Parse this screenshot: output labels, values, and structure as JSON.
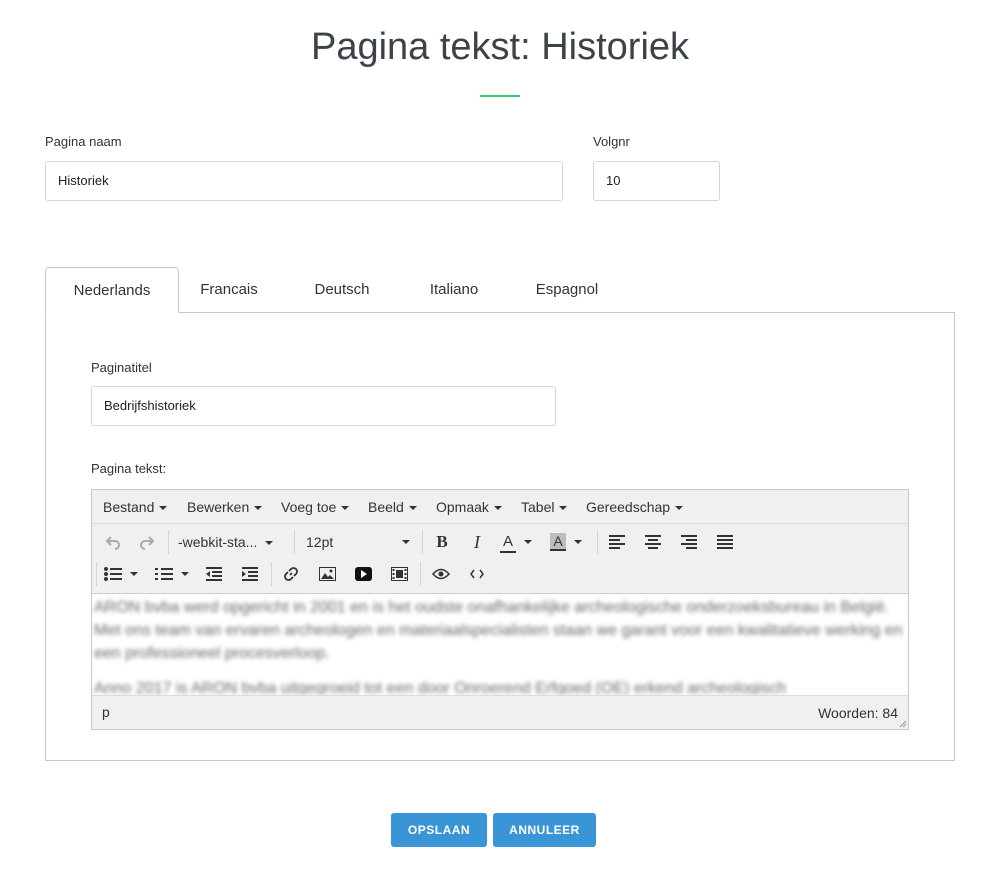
{
  "page": {
    "title": "Pagina tekst: Historiek"
  },
  "form": {
    "name_label": "Pagina naam",
    "name_value": "Historiek",
    "order_label": "Volgnr",
    "order_value": "10"
  },
  "tabs": [
    "Nederlands",
    "Francais",
    "Deutsch",
    "Italiano",
    "Espagnol"
  ],
  "active_tab": "Nederlands",
  "panel": {
    "title_label": "Paginatitel",
    "title_value": "Bedrijfshistoriek",
    "text_label": "Pagina tekst:"
  },
  "editor": {
    "menu": [
      "Bestand",
      "Bewerken",
      "Voeg toe",
      "Beeld",
      "Opmaak",
      "Tabel",
      "Gereedschap"
    ],
    "font_family": "-webkit-sta...",
    "font_size": "12pt",
    "content": [
      "ARON bvba werd opgericht in 2001 en is het oudste onafhankelijke archeologische onderzoeksbureau in België. Met ons team van ervaren archeologen en materiaalspecialisten staan we garant voor een kwalitatieve werking en een professioneel procesverloop.",
      "Anno 2017 is ARON bvba uitgegroeid tot een door Onroerend Erfgoed (OE) erkend archeologisch"
    ],
    "status_path": "p",
    "word_count": "Woorden: 84"
  },
  "buttons": {
    "save": "OPSLAAN",
    "cancel": "ANNULEER"
  },
  "colors": {
    "accent": "#2ecc71",
    "button": "#3a95d7"
  },
  "icons": [
    "undo-icon",
    "redo-icon",
    "bold-icon",
    "italic-icon",
    "text-color-icon",
    "background-color-icon",
    "align-left-icon",
    "align-center-icon",
    "align-right-icon",
    "align-justify-icon",
    "bullet-list-icon",
    "numbered-list-icon",
    "outdent-icon",
    "indent-icon",
    "link-icon",
    "image-icon",
    "media-icon",
    "video-icon",
    "preview-icon",
    "source-code-icon"
  ]
}
